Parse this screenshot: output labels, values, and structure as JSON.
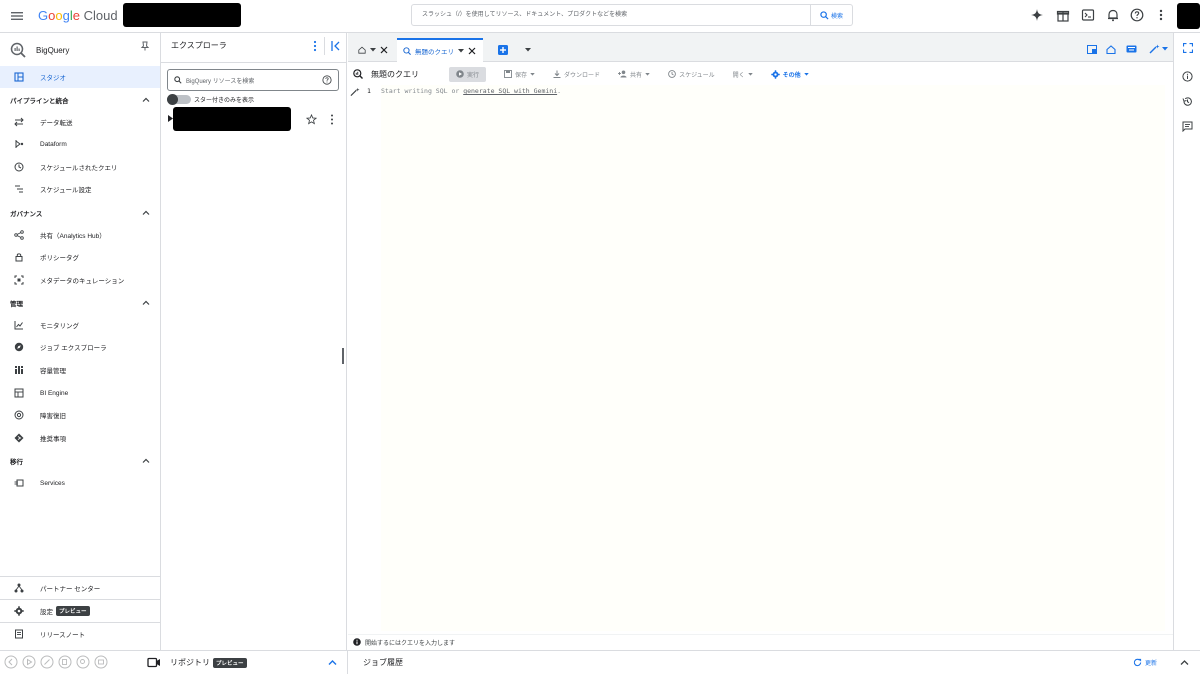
{
  "topbar": {
    "logo_google": [
      "G",
      "o",
      "o",
      "g",
      "l",
      "e"
    ],
    "logo_cloud": "Cloud",
    "search_placeholder": "スラッシュ（/）を使用してリソース、ドキュメント、プロダクトなどを検索",
    "search_button": "検索"
  },
  "product": {
    "name": "BigQuery"
  },
  "nav": {
    "studio": "スタジオ",
    "section_pipeline": "パイプラインと統合",
    "data_transfer": "データ転送",
    "dataform": "Dataform",
    "scheduled_queries": "スケジュールされたクエリ",
    "schedule_settings": "スケジュール設定",
    "section_governance": "ガバナンス",
    "analytics_hub": "共有（Analytics Hub）",
    "policy_tags": "ポリシータグ",
    "metadata_curation": "メタデータのキュレーション",
    "section_admin": "管理",
    "monitoring": "モニタリング",
    "jobs_explorer": "ジョブ エクスプローラ",
    "capacity": "容量管理",
    "bi_engine": "BI Engine",
    "disaster_recovery": "障害復旧",
    "recommendations": "推奨事項",
    "section_migration": "移行",
    "services": "Services",
    "partner_center": "パートナー センター",
    "settings": "設定",
    "settings_badge": "プレビュー",
    "release_notes": "リリースノート"
  },
  "explorer": {
    "title": "エクスプローラ",
    "search_placeholder": "BigQuery リソースを検索",
    "starred_only": "スター付きのみを表示",
    "repository": "リポジトリ",
    "repository_badge": "プレビュー"
  },
  "editor": {
    "tab_title": "無題のクエリ",
    "query_title": "無題のクエリ",
    "toolbar": {
      "run": "実行",
      "save": "保存",
      "download": "ダウンロード",
      "share": "共有",
      "schedule": "スケジュール",
      "open": "開く",
      "more": "その他"
    },
    "line_number": "1",
    "code_prefix": "Start writing SQL or ",
    "code_link": "generate SQL with Gemini",
    "code_suffix": ".",
    "status": "開始するにはクエリを入力します"
  },
  "bottom": {
    "job_history": "ジョブ履歴",
    "refresh": "更新"
  },
  "colors": {
    "accent": "#1a73e8",
    "active_bg": "#e8f0fe",
    "border": "#dadce0"
  }
}
